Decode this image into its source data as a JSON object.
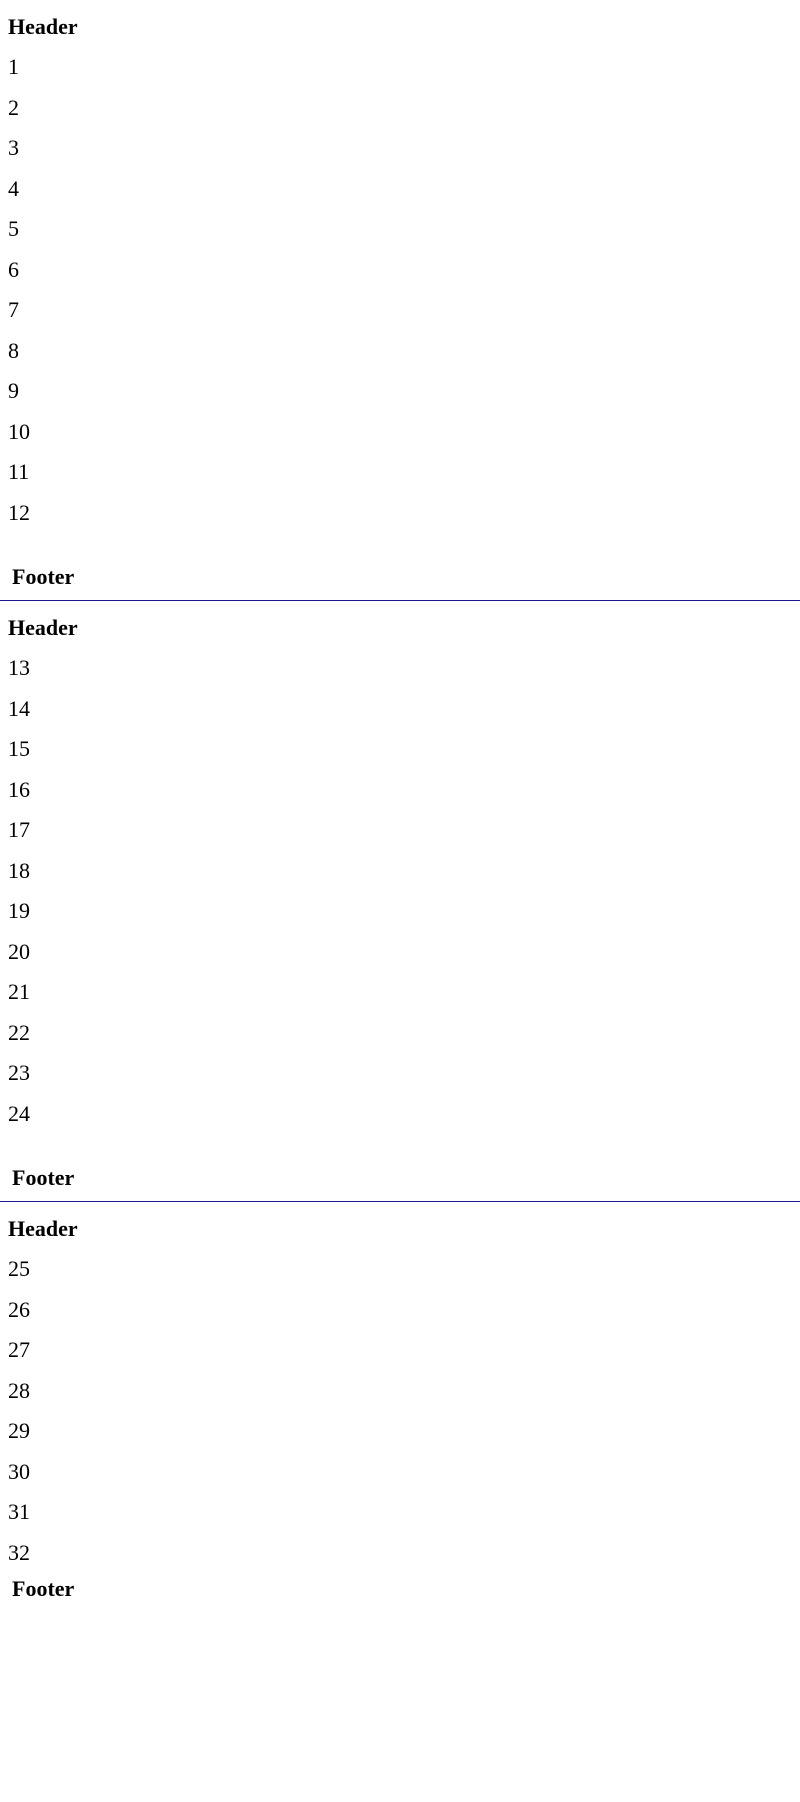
{
  "pages": [
    {
      "header": "Header",
      "rows": [
        "1",
        "2",
        "3",
        "4",
        "5",
        "6",
        "7",
        "8",
        "9",
        "10",
        "11",
        "12"
      ],
      "footer": "Footer"
    },
    {
      "header": "Header",
      "rows": [
        "13",
        "14",
        "15",
        "16",
        "17",
        "18",
        "19",
        "20",
        "21",
        "22",
        "23",
        "24"
      ],
      "footer": "Footer"
    },
    {
      "header": "Header",
      "rows": [
        "25",
        "26",
        "27",
        "28",
        "29",
        "30",
        "31",
        "32"
      ],
      "footer": "Footer"
    }
  ],
  "colors": {
    "divider": "#1a1a8c",
    "text": "#000000",
    "background": "#ffffff"
  }
}
